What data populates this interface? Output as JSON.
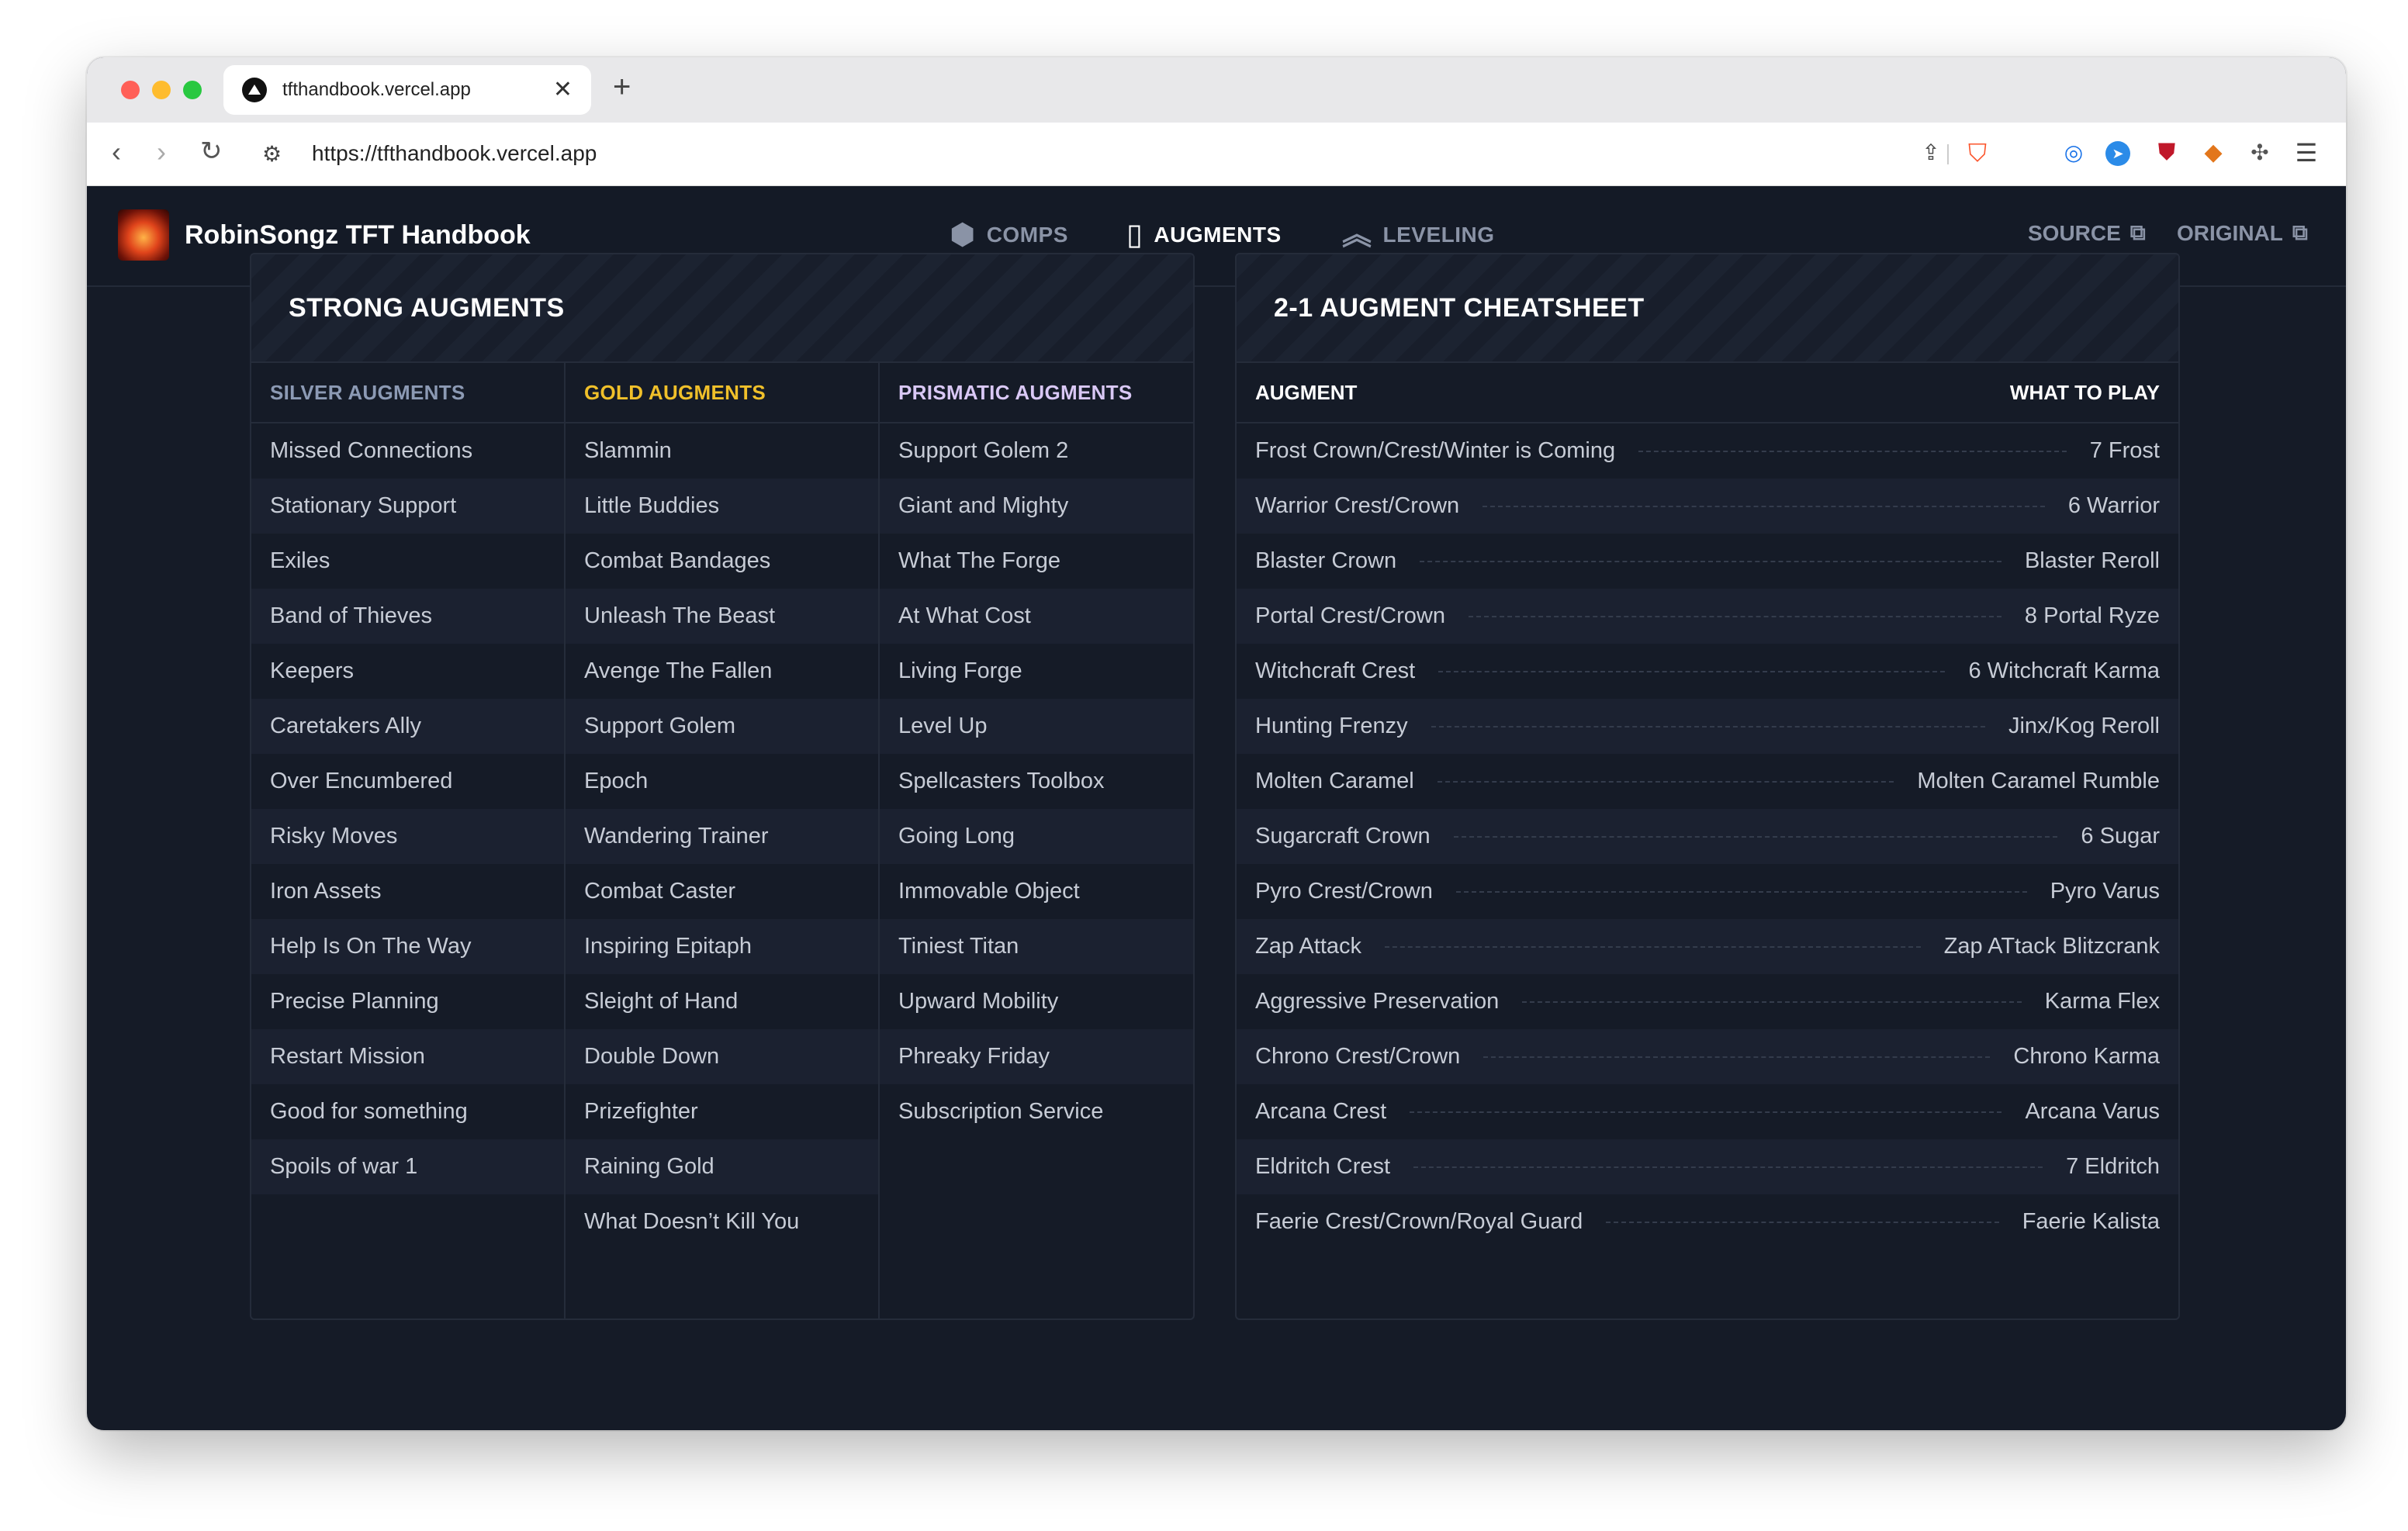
{
  "browser": {
    "tab_title": "tfthandbook.vercel.app",
    "tab_close": "✕",
    "new_tab": "+",
    "url": "https://tfthandbook.vercel.app"
  },
  "app": {
    "brand": "RobinSongz TFT Handbook",
    "nav": [
      {
        "label": "COMPS",
        "icon": "cubes-icon"
      },
      {
        "label": "AUGMENTS",
        "icon": "cards-icon"
      },
      {
        "label": "LEVELING",
        "icon": "double-chevron-up-icon"
      }
    ],
    "links": [
      {
        "label": "SOURCE",
        "icon": "external-link-icon"
      },
      {
        "label": "ORIGINAL",
        "icon": "external-link-icon"
      }
    ]
  },
  "strong_augments": {
    "title": "STRONG AUGMENTS",
    "silver": {
      "header": "SILVER AUGMENTS",
      "items": [
        "Missed Connections",
        "Stationary Support",
        "Exiles",
        "Band of Thieves",
        "Keepers",
        "Caretakers Ally",
        "Over Encumbered",
        "Risky Moves",
        "Iron Assets",
        "Help Is On The Way",
        "Precise Planning",
        "Restart Mission",
        "Good for something",
        "Spoils of war 1"
      ]
    },
    "gold": {
      "header": "GOLD AUGMENTS",
      "items": [
        "Slammin",
        "Little Buddies",
        "Combat Bandages",
        "Unleash The Beast",
        "Avenge The Fallen",
        "Support Golem",
        "Epoch",
        "Wandering Trainer",
        "Combat Caster",
        "Inspiring Epitaph",
        "Sleight of Hand",
        "Double Down",
        "Prizefighter",
        "Raining Gold",
        "What Doesn’t Kill You"
      ]
    },
    "prismatic": {
      "header": "PRISMATIC AUGMENTS",
      "items": [
        "Support Golem 2",
        "Giant and Mighty",
        "What The Forge",
        "At What Cost",
        "Living Forge",
        "Level Up",
        "Spellcasters Toolbox",
        "Going Long",
        "Immovable Object",
        "Tiniest Titan",
        "Upward Mobility",
        "Phreaky Friday",
        "Subscription Service"
      ]
    }
  },
  "cheatsheet": {
    "title": "2-1 AUGMENT CHEATSHEET",
    "col_augment": "AUGMENT",
    "col_play": "WHAT TO PLAY",
    "rows": [
      {
        "augment": "Frost Crown/Crest/Winter is Coming",
        "play": "7 Frost"
      },
      {
        "augment": "Warrior Crest/Crown",
        "play": "6 Warrior"
      },
      {
        "augment": "Blaster Crown",
        "play": "Blaster Reroll"
      },
      {
        "augment": "Portal Crest/Crown",
        "play": "8 Portal Ryze"
      },
      {
        "augment": "Witchcraft Crest",
        "play": "6 Witchcraft Karma"
      },
      {
        "augment": "Hunting Frenzy",
        "play": "Jinx/Kog Reroll"
      },
      {
        "augment": "Molten Caramel",
        "play": "Molten Caramel Rumble"
      },
      {
        "augment": "Sugarcraft Crown",
        "play": "6 Sugar"
      },
      {
        "augment": "Pyro Crest/Crown",
        "play": "Pyro Varus"
      },
      {
        "augment": "Zap Attack",
        "play": "Zap ATtack Blitzcrank"
      },
      {
        "augment": "Aggressive Preservation",
        "play": "Karma Flex"
      },
      {
        "augment": "Chrono Crest/Crown",
        "play": "Chrono Karma"
      },
      {
        "augment": "Arcana Crest",
        "play": "Arcana Varus"
      },
      {
        "augment": "Eldritch Crest",
        "play": "7 Eldritch"
      },
      {
        "augment": "Faerie Crest/Crown/Royal Guard",
        "play": "Faerie Kalista"
      }
    ]
  }
}
